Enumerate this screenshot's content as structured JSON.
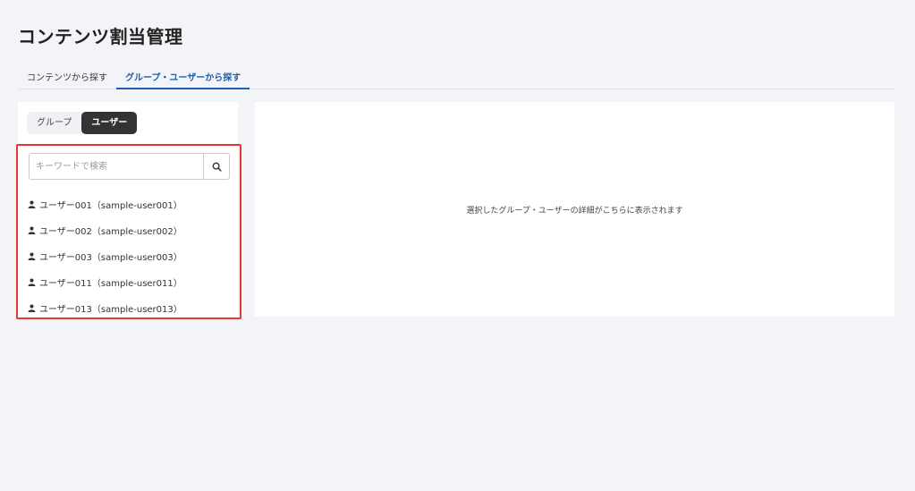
{
  "page": {
    "title": "コンテンツ割当管理"
  },
  "tabs": [
    {
      "label": "コンテンツから探す",
      "active": false
    },
    {
      "label": "グループ・ユーザーから探す",
      "active": true
    }
  ],
  "toggle": {
    "group_label": "グループ",
    "user_label": "ユーザー",
    "selected": "ユーザー"
  },
  "search": {
    "placeholder": "キーワードで検索",
    "value": "",
    "icon": "search-icon"
  },
  "users": [
    {
      "label": "ユーザー001（sample-user001）",
      "icon": "person-icon"
    },
    {
      "label": "ユーザー002（sample-user002）",
      "icon": "person-icon"
    },
    {
      "label": "ユーザー003（sample-user003）",
      "icon": "person-icon"
    },
    {
      "label": "ユーザー011（sample-user011）",
      "icon": "person-icon"
    },
    {
      "label": "ユーザー013（sample-user013）",
      "icon": "person-icon"
    }
  ],
  "detail": {
    "placeholder": "選択したグループ・ユーザーの詳細がこちらに表示されます"
  },
  "colors": {
    "accent": "#1a5fb4",
    "highlight": "#e53935",
    "toggle_active": "#333333"
  }
}
